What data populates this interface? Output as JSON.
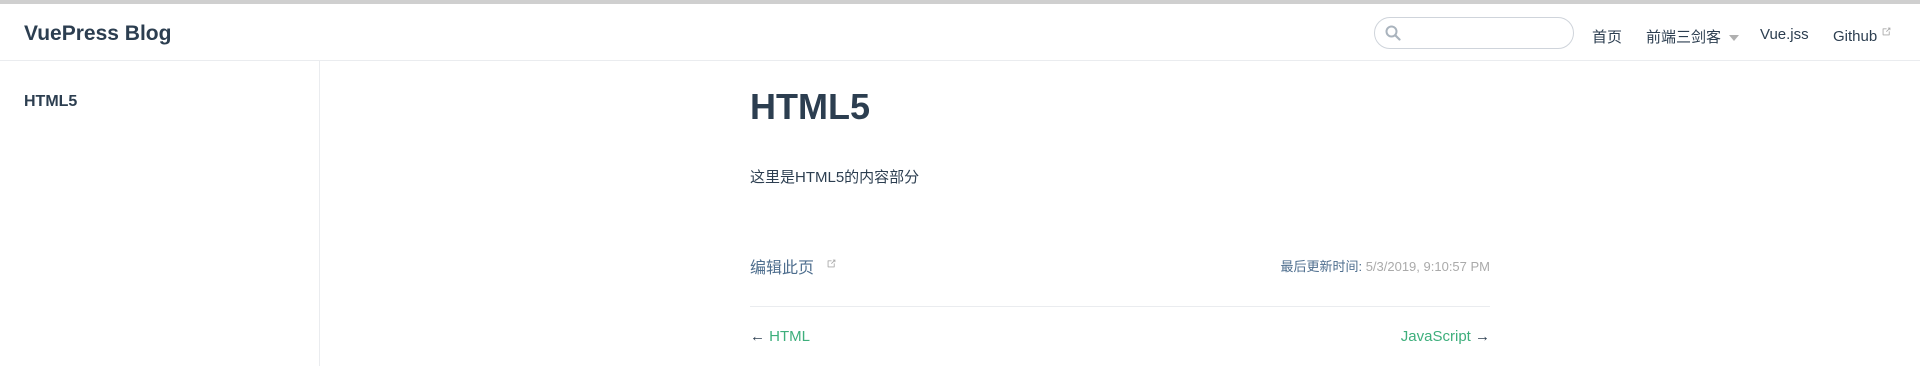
{
  "navbar": {
    "site_name": "VuePress Blog",
    "search": {
      "value": "",
      "placeholder": ""
    },
    "links": [
      {
        "label": "首页"
      },
      {
        "label": "前端三剑客",
        "dropdown": true
      },
      {
        "label": "Vue.jss"
      },
      {
        "label": "Github",
        "external": true
      }
    ]
  },
  "sidebar": {
    "items": [
      {
        "label": "HTML5",
        "active": true
      }
    ]
  },
  "page": {
    "title": "HTML5",
    "content": "这里是HTML5的内容部分",
    "edit_link": "编辑此页",
    "last_updated_prefix": "最后更新时间:",
    "last_updated_time": "5/3/2019, 9:10:57 PM",
    "prev": {
      "arrow": "←",
      "label": "HTML"
    },
    "next": {
      "label": "JavaScript",
      "arrow": "→"
    }
  },
  "colors": {
    "accent": "#3eaf7c",
    "text": "#2c3e50",
    "muted": "#aaaaaa"
  }
}
